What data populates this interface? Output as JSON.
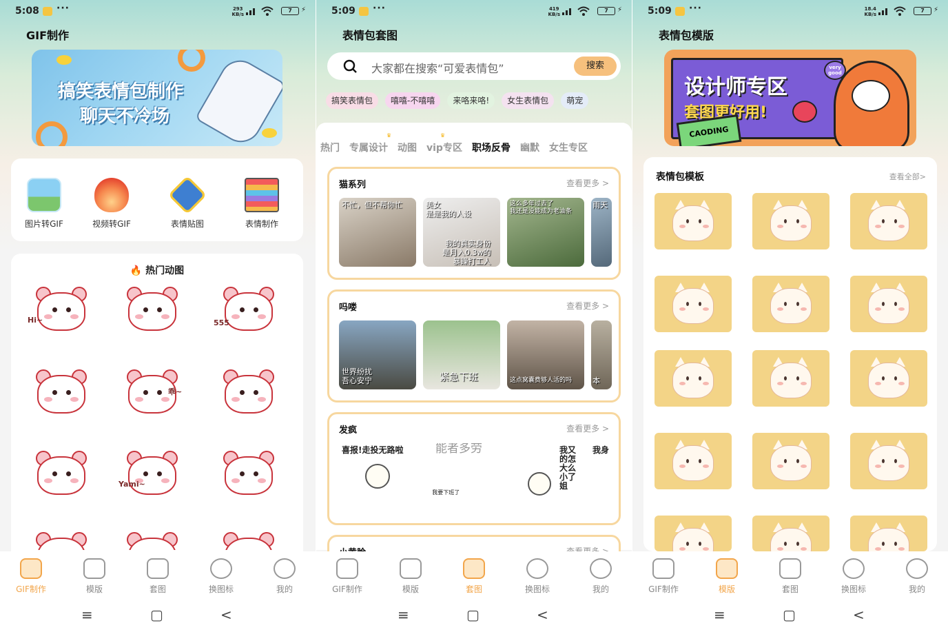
{
  "screens": [
    {
      "status": {
        "time": "5:08",
        "speed": "293\nKB/s",
        "battery": "7"
      },
      "title": "GIF制作",
      "banner": {
        "line1": "搞笑表情包制作",
        "line2": "聊天不冷场"
      },
      "tools": [
        {
          "label": "图片转GIF",
          "icon": "image-icon"
        },
        {
          "label": "视频转GIF",
          "icon": "flame-icon"
        },
        {
          "label": "表情贴图",
          "icon": "crown-badge-icon"
        },
        {
          "label": "表情制作",
          "icon": "layers-icon"
        }
      ],
      "hot_title": "热门动图",
      "bear_texts": [
        "Hi~",
        "555",
        "乖~",
        "Yami~"
      ],
      "active_tab": 0
    },
    {
      "status": {
        "time": "5:09",
        "speed": "419\nKB/s",
        "battery": "7"
      },
      "title": "表情包套图",
      "search": {
        "placeholder": "大家都在搜索“可爱表情包”",
        "button": "搜索"
      },
      "chips": [
        "搞笑表情包",
        "嘻嘻-不嘻嘻",
        "来咯来咯!",
        "女生表情包",
        "萌宠"
      ],
      "tabs": [
        "热门",
        "专属设计",
        "动图",
        "vip专区",
        "职场反骨",
        "幽默",
        "女生专区"
      ],
      "active_category": "职场反骨",
      "series": [
        {
          "name": "猫系列",
          "more": "查看更多 >",
          "captions": [
            "不忙，但不帮你忙",
            "美女\n是是我的人设",
            "我的真实身份\n是月入0.3w的\n暴躁打工人",
            "这么多年过去了\n我还是没能成为老油条",
            "雨天"
          ]
        },
        {
          "name": "吗喽",
          "more": "查看更多 >",
          "captions": [
            "世界纷扰\n吾心安宁",
            "紧急下班",
            "这点窝囊费够人活的吗",
            "本"
          ]
        },
        {
          "name": "发疯",
          "more": "查看更多 >",
          "captions": [
            "喜报!走投无路啦",
            "能者多劳",
            "我要下班了\n那你能吧 我不能",
            "我又\n的怎\n大么\n小了\n姐",
            "我身"
          ]
        },
        {
          "name": "小黄脸",
          "more": "查看更多 >"
        }
      ],
      "active_tab": 2
    },
    {
      "status": {
        "time": "5:09",
        "speed": "18.4\nKB/s",
        "battery": "7"
      },
      "title": "表情包模版",
      "banner": {
        "line1": "设计师专区",
        "line2": "套图更好用!",
        "tag": "very\ngood",
        "box": "CAODING"
      },
      "section_title": "表情包模板",
      "section_more": "查看全部>",
      "active_tab": 1
    }
  ],
  "nav": [
    "GIF制作",
    "模版",
    "套图",
    "换图标",
    "我的"
  ],
  "nav_icons": [
    "gif-face-icon",
    "template-icon",
    "image-set-icon",
    "swap-icon",
    "profile-icon"
  ],
  "sysnav": [
    "≡",
    "▢",
    "<"
  ],
  "colors": {
    "accent": "#f2a54a",
    "chip": "#f8dde6",
    "series_border": "#f7d79f",
    "cat_bg": "#f3d487"
  }
}
